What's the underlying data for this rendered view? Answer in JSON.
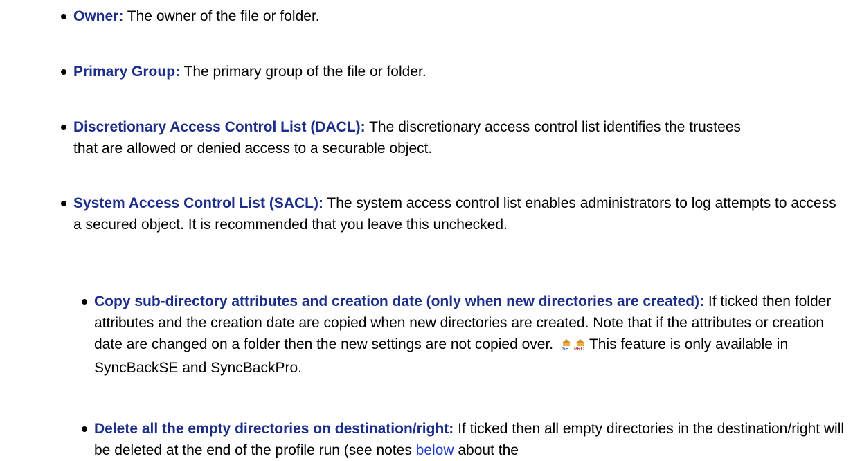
{
  "security_items": [
    {
      "term": "Owner:",
      "description": " The owner of the file or folder."
    },
    {
      "term": "Primary Group:",
      "description": " The primary group of the file or folder."
    },
    {
      "term": "Discretionary Access Control List (DACL):",
      "description": " The discretionary access control list identifies the trustees that are allowed or denied access to a securable object."
    },
    {
      "term": "System Access Control List (SACL):",
      "description": " The system access control list enables administrators to log attempts to access a secured object. It is recommended that you leave this unchecked."
    }
  ],
  "options": [
    {
      "term": "Copy sub-directory attributes and creation date (only when new directories are created):",
      "description_before_icons": " If ticked then folder attributes and the creation date are copied when new directories are created. Note that if the attributes or creation date are changed on a folder then the new settings are not copied over.",
      "edition_icons": [
        "SE",
        "PRO"
      ],
      "description_after_icons": "This feature is only available in SyncBackSE and SyncBackPro."
    },
    {
      "term": "Delete all the empty directories on destination/right:",
      "description_before_link": " If ticked then all empty directories in the destination/right will be deleted at the end of the profile run (see notes ",
      "link_text": "below",
      "description_after_link": " about the"
    }
  ],
  "colors": {
    "term": "#1c2e8c",
    "link": "#1e3bd6",
    "se_icon": "#d98c1f",
    "pro_icon": "#d98c1f"
  }
}
